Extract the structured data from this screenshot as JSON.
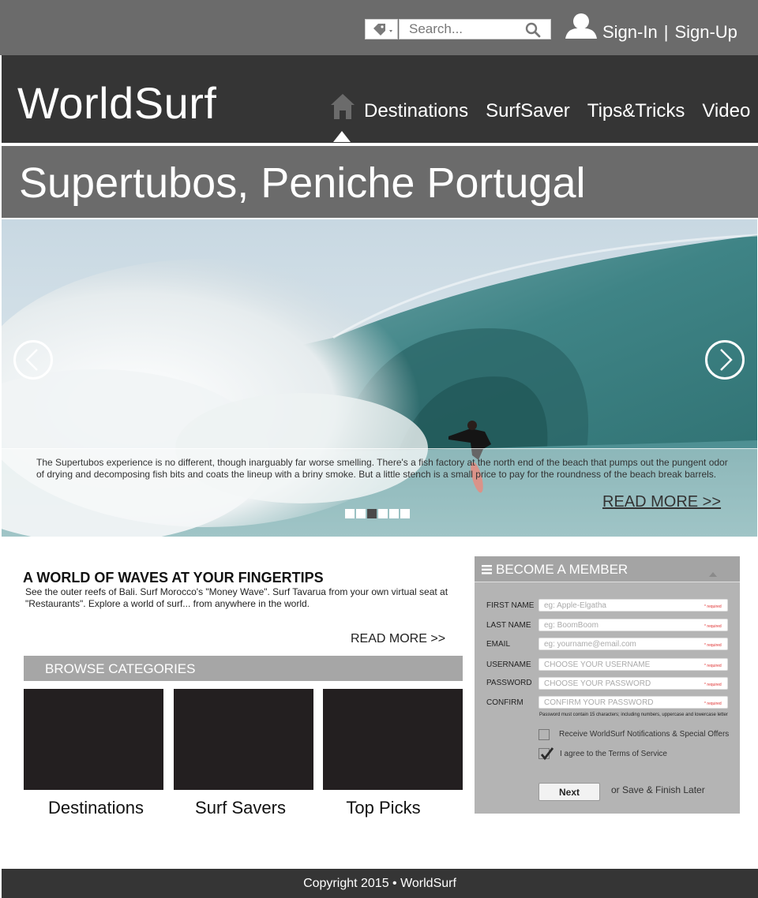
{
  "topbar": {
    "search_placeholder": "Search...",
    "sign_in": "Sign-In",
    "separator": "|",
    "sign_up": "Sign-Up"
  },
  "header": {
    "logo": "WorldSurf",
    "nav": [
      "Destinations",
      "SurfSaver",
      "Tips&Tricks",
      "Video"
    ]
  },
  "page_title": "Supertubos, Peniche Portugal",
  "hero": {
    "caption": "The Supertubos experience is no different, though inarguably far worse smelling. There's a fish factory at the north end of the beach that pumps out the pungent odor of drying and decomposing fish bits and coats the lineup with a briny smoke. But a little stench is a small price to pay for the roundness of the beach break barrels.",
    "read_more": "READ MORE >>",
    "slide_count": 6,
    "active_slide": 3
  },
  "intro": {
    "heading": "A WORLD OF WAVES AT YOUR FINGERTIPS",
    "text": "See the outer reefs of Bali. Surf Morocco's \"Money Wave\". Surf Tavarua from your own virtual seat at \"Restaurants\". Explore a world of surf... from anywhere in the world.",
    "read_more": "READ MORE >>"
  },
  "browse": {
    "title": "BROWSE CATEGORIES",
    "categories": [
      "Destinations",
      "Surf Savers",
      "Top Picks"
    ]
  },
  "member": {
    "title": "BECOME A MEMBER",
    "fields": [
      {
        "label": "FIRST NAME",
        "placeholder": "eg: Apple-Elgatha",
        "required": "* required"
      },
      {
        "label": "LAST NAME",
        "placeholder": "eg: BoomBoom",
        "required": "* required"
      },
      {
        "label": "EMAIL",
        "placeholder": "eg: yourname@email.com",
        "required": "* required"
      },
      {
        "label": "USERNAME",
        "placeholder": "CHOOSE YOUR USERNAME",
        "required": "* required"
      },
      {
        "label": "PASSWORD",
        "placeholder": "CHOOSE YOUR PASSWORD",
        "required": "* required"
      },
      {
        "label": "CONFIRM",
        "placeholder": "CONFIRM YOUR PASSWORD",
        "required": "* required"
      }
    ],
    "password_note": "Password must contain 15 characters; including numbers, uppercase and lowercase letter",
    "notifications_label": "Receive WorldSurf Notifications & Special Offers",
    "notifications_checked": false,
    "terms_label": "I agree to the Terms of Service",
    "terms_checked": true,
    "next_label": "Next",
    "save_later": "or Save & Finish Later"
  },
  "footer": {
    "copyright": "Copyright 2015 • WorldSurf"
  },
  "colors": {
    "topbar": "#6b6b6b",
    "header": "#353535",
    "panel": "#b4b4b4",
    "tile": "#231f20"
  }
}
